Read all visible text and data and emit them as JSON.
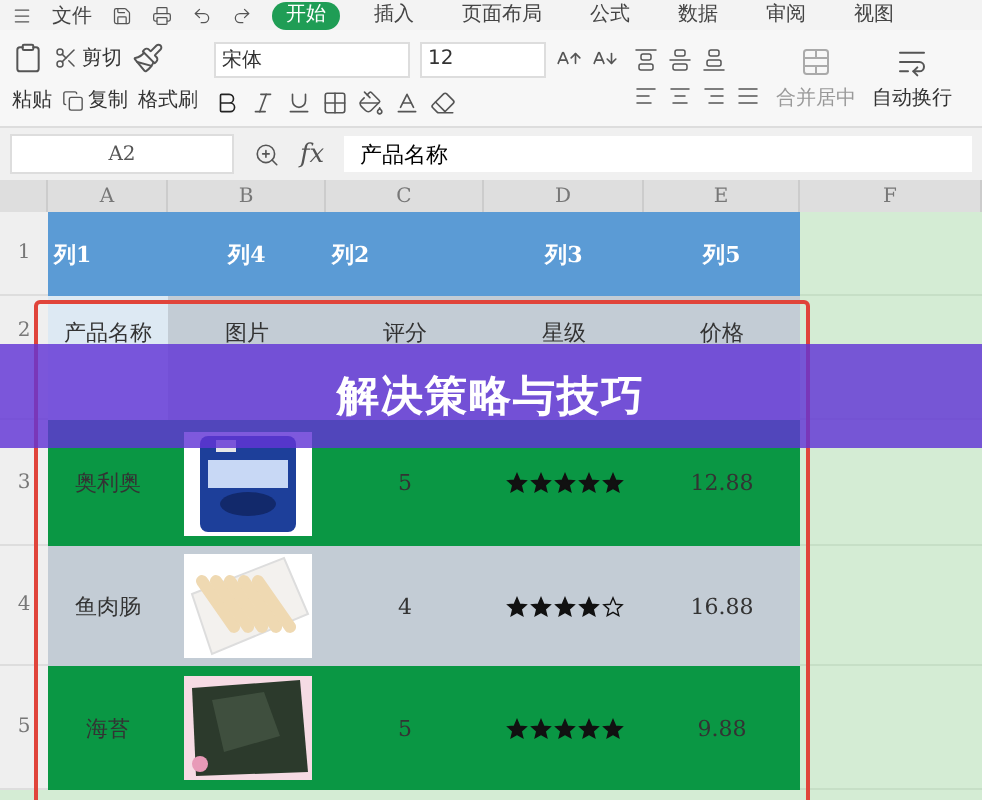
{
  "menu": {
    "file_label": "文件",
    "tabs": [
      {
        "label": "开始",
        "selected": true
      },
      {
        "label": "插入",
        "selected": false
      },
      {
        "label": "页面布局",
        "selected": false
      },
      {
        "label": "公式",
        "selected": false
      },
      {
        "label": "数据",
        "selected": false
      },
      {
        "label": "审阅",
        "selected": false
      },
      {
        "label": "视图",
        "selected": false
      }
    ]
  },
  "ribbon": {
    "paste": "粘贴",
    "cut": "剪切",
    "copy": "复制",
    "format_painter": "格式刷",
    "font": "宋体",
    "size": "12",
    "merge": "合并居中",
    "wrap": "自动换行"
  },
  "formula_bar": {
    "cell_ref": "A2",
    "fx": "fx",
    "value": "产品名称"
  },
  "columns": [
    "A",
    "B",
    "C",
    "D",
    "E",
    "F"
  ],
  "header_row": {
    "number": "1",
    "cells": [
      "列1",
      "列4",
      "列2",
      "列3",
      "列5"
    ]
  },
  "label_row": {
    "number": "2",
    "color": "#c3ccd5",
    "cells": [
      "产品名称",
      "图片",
      "评分",
      "星级",
      "价格"
    ]
  },
  "rows": [
    {
      "number": "3",
      "color": "#0a9744",
      "name": "奥利奥",
      "rating": "5",
      "stars": 5,
      "price": "12.88"
    },
    {
      "number": "4",
      "color": "#c3ccd5",
      "name": "鱼肉肠",
      "rating": "4",
      "stars": 4,
      "price": "16.88"
    },
    {
      "number": "5",
      "color": "#0a9744",
      "name": "海苔",
      "rating": "5",
      "stars": 5,
      "price": "9.88"
    }
  ],
  "banner": {
    "title": "解决策略与技巧"
  }
}
